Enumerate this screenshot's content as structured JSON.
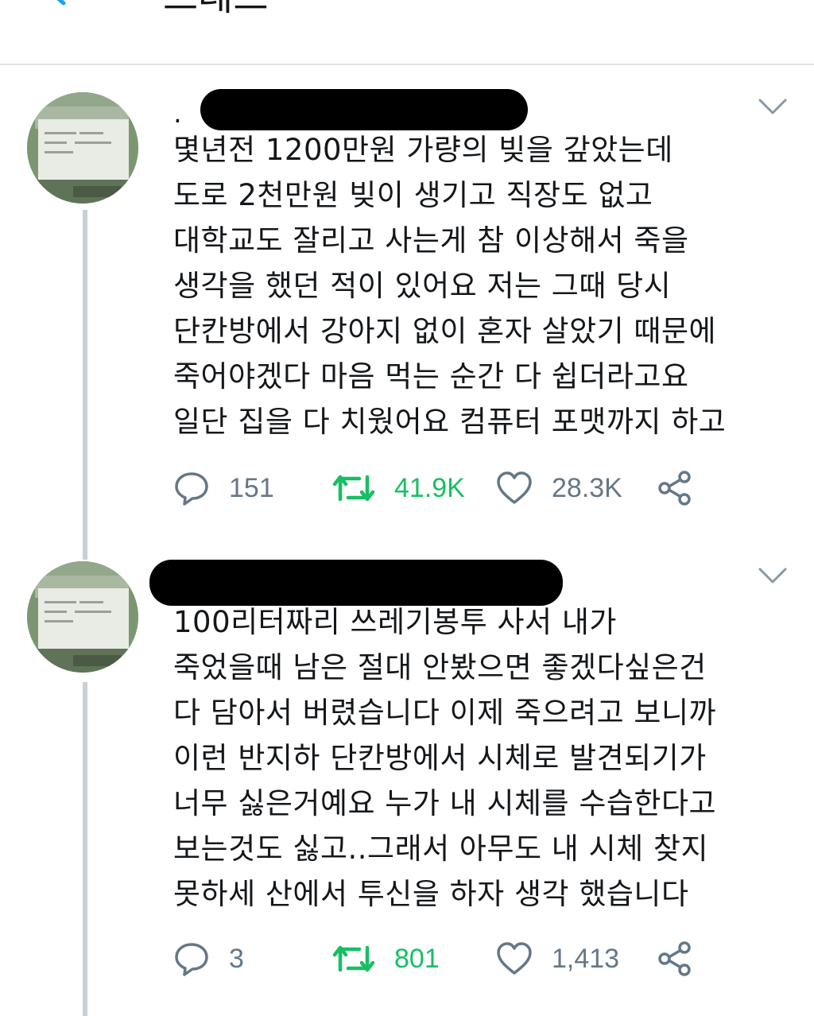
{
  "header": {
    "title": "스레드"
  },
  "colors": {
    "accent": "#1da1f2",
    "retweet_active": "#17bf63",
    "muted": "#657786"
  },
  "tweets": [
    {
      "prefix": ".",
      "text": "몇년전 1200만원 가량의 빚을 갚았는데\n도로 2천만원 빚이 생기고 직장도 없고\n대학교도 잘리고 사는게 참 이상해서 죽을\n생각을 했던 적이 있어요 저는 그때 당시\n단칸방에서 강아지 없이 혼자 살았기 때문에\n죽어야겠다 마음 먹는 순간 다 쉽더라고요\n일단 집을 다 치웠어요 컴퓨터 포맷까지 하고",
      "replies": "151",
      "retweets": "41.9K",
      "likes": "28.3K",
      "retweeted": true
    },
    {
      "prefix": "",
      "text": "100리터짜리 쓰레기봉투 사서 내가\n죽었을때 남은 절대 안봤으면 좋겠다싶은건\n다 담아서 버렸습니다 이제 죽으려고 보니까\n이런 반지하 단칸방에서 시체로 발견되기가\n너무 싫은거예요 누가 내 시체를 수습한다고\n보는것도 싫고..그래서 아무도 내 시체 찾지\n못하세 산에서 투신을 하자 생각 했습니다",
      "replies": "3",
      "retweets": "801",
      "likes": "1,413",
      "retweeted": true
    }
  ],
  "icons": [
    "back-arrow-icon",
    "chevron-down-icon",
    "reply-icon",
    "retweet-icon",
    "like-icon",
    "share-icon"
  ]
}
